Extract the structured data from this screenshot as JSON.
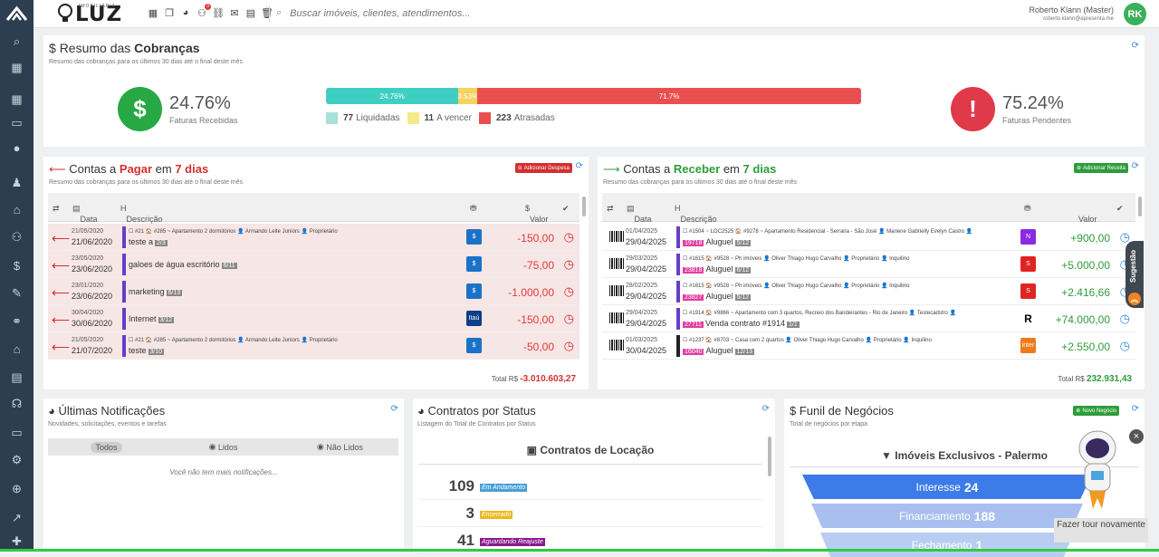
{
  "brand": {
    "sub": "IMOBILIÁRIA",
    "name": "LUZ"
  },
  "topbar": {
    "icons": [
      "dashboard-icon",
      "clone-icon",
      "comments-icon",
      "users-icon",
      "link-icon",
      "envelope-icon",
      "calendar-icon",
      "trash-icon"
    ],
    "notif_count": "3",
    "search_placeholder": "Buscar imóveis, clientes, atendimentos...",
    "user_name": "Roberto Klann (Master)",
    "user_email": "roberto.klann@apresenta.me",
    "avatar_initials": "RK"
  },
  "resumo": {
    "title_prefix": "Resumo das ",
    "title_bold": "Cobranças",
    "subtitle": "Resumo das cobranças para os últimos 30 dias até o final deste mês",
    "received_pct": "24.76%",
    "received_label": "Faturas Recebidas",
    "pending_pct": "75.24%",
    "pending_label": "Faturas Pendentes",
    "bar": [
      {
        "label": "24.76%",
        "value": 24.76,
        "color": "#3fcfc0"
      },
      {
        "label": "3.53%",
        "value": 3.53,
        "color": "#f4d35e"
      },
      {
        "label": "71.7%",
        "value": 71.7,
        "color": "#e94f4f"
      }
    ],
    "legend": [
      {
        "count": "77",
        "label": "Liquidadas",
        "color": "#a8e0da"
      },
      {
        "count": "11",
        "label": "A vencer",
        "color": "#f5e98a"
      },
      {
        "count": "223",
        "label": "Atrasadas",
        "color": "#e94f4f"
      }
    ]
  },
  "pagar": {
    "title_a": "Contas a ",
    "title_b": "Pagar",
    "title_c": " em ",
    "title_d": "7 dias",
    "subtitle": "Resumo das cobranças para os últimos 30 dias até o final deste mês",
    "button": "Adicionar Despesa",
    "col_data": "Data",
    "col_desc": "Descrição",
    "col_valor": "Valor",
    "rows": [
      {
        "d1": "21/05/2020",
        "d2": "21/06/2020",
        "meta": "☐ #21   🏠 #285 ~ Apartamento 2 dormitórios   👤 Armando Leite Juniors   👤 Proprietário",
        "desc": "teste a",
        "tag": "2/3",
        "bank": "$",
        "bank_color": "#1a73c8",
        "value": "-150,00"
      },
      {
        "d1": "23/05/2020",
        "d2": "23/06/2020",
        "meta": "",
        "desc": "galoes de água escritório",
        "tag": "6/11",
        "bank": "$",
        "bank_color": "#1a73c8",
        "value": "-75,00"
      },
      {
        "d1": "23/01/2020",
        "d2": "23/06/2020",
        "meta": "",
        "desc": "marketing",
        "tag": "6/13",
        "bank": "$",
        "bank_color": "#1a73c8",
        "value": "-1.000,00"
      },
      {
        "d1": "30/04/2020",
        "d2": "30/06/2020",
        "meta": "",
        "desc": "Internet",
        "tag": "3/12",
        "bank": "Itaú",
        "bank_color": "#0b3f8a",
        "value": "-150,00"
      },
      {
        "d1": "21/05/2020",
        "d2": "21/07/2020",
        "meta": "☐ #21   🏠 #285 ~ Apartamento 2 dormitórios   👤 Armando Leite Juniors   👤 Proprietário",
        "desc": "teste",
        "tag": "3/10",
        "bank": "$",
        "bank_color": "#1a73c8",
        "value": "-50,00"
      }
    ],
    "total_label": "Total R$",
    "total_value": "-3.010.603,27"
  },
  "receber": {
    "title_a": "Contas a ",
    "title_b": "Receber",
    "title_c": " em ",
    "title_d": "7 dias",
    "subtitle": "Resumo das cobranças para os últimos 30 dias até o final deste mês",
    "button": "Adicionar Receita",
    "col_data": "Data",
    "col_desc": "Descrição",
    "col_valor": "Valor",
    "rows": [
      {
        "d1": "01/04/2025",
        "d2": "29/04/2025",
        "meta": "☐ #1504 ~ LOC2525   🏠 #9278 ~ Apartamento Residencial - Serraria - São José   👤 Mariene Gabrielly Evelyn Castro   👤",
        "code": "19718",
        "desc": "Aluguel",
        "tag": "5/12",
        "bank": "N",
        "bank_color": "#8a2be2",
        "value": "+900,00"
      },
      {
        "d1": "29/03/2025",
        "d2": "29/04/2025",
        "meta": "☐ #1615   🏠 #9528 ~ Ph imóveis   👤 Oliver Thiago Hugo Carvalho   👤 Proprietário   👤 Inquilino",
        "code": "23818",
        "desc": "Aluguel",
        "tag": "6/12",
        "bank": "S",
        "bank_color": "#e02424",
        "value": "+5.000,00"
      },
      {
        "d1": "28/02/2025",
        "d2": "29/04/2025",
        "meta": "☐ #1615   🏠 #9528 ~ Ph imóveis   👤 Oliver Thiago Hugo Carvalho   👤 Proprietário   👤 Inquilino",
        "code": "23827",
        "desc": "Aluguel",
        "tag": "5/12",
        "bank": "S",
        "bank_color": "#e02424",
        "value": "+2.416,66"
      },
      {
        "d1": "29/04/2025",
        "d2": "29/04/2025",
        "meta": "☐ #1914   🏠 #9866 ~ Apartamento com 3 quartos, Recreio dos Bandeirantes - Rio de Janeiro   👤 Testecadstro   👤",
        "code": "27711",
        "desc": "Venda contrato #1914",
        "tag": "1/1",
        "bank": "R",
        "bank_color": "#fff",
        "value": "+74.000,00"
      },
      {
        "d1": "01/03/2025",
        "d2": "30/04/2025",
        "meta": "☐ #1237   🏠 #8703 ~ Casa com 2 quartos   👤 Oliver Thiago Hugo Carvalho   👤 Proprietário   👤 Inquilino",
        "code": "16040",
        "desc": "Aluguel",
        "tag": "12/13",
        "bank": "inter",
        "bank_color": "#f07a1a",
        "value": "+2.550,00"
      }
    ],
    "total_label": "Total R$",
    "total_value": "232.931,43"
  },
  "notif": {
    "title": "Últimas Notificações",
    "subtitle": "Novidades, solicitações, eventos e tarefas",
    "tab_all": "Todos",
    "tab_read": "Lidos",
    "tab_unread": "Não Lidos",
    "empty": "Você não tem mais notificações..."
  },
  "contratos": {
    "title": "Contratos por Status",
    "subtitle": "Listagem do Total de Contratos por Status",
    "section": "Contratos de Locação",
    "rows": [
      {
        "num": "109",
        "label": "Em Andamento",
        "color": "#4a9fd8"
      },
      {
        "num": "3",
        "label": "Encerrado",
        "color": "#e8b923"
      },
      {
        "num": "41",
        "label": "Aguardando Reajuste",
        "color": "#8b1a8b"
      }
    ]
  },
  "funil": {
    "title": "Funil de Negócios",
    "subtitle": "Total de negócios por etapa",
    "button": "Novo Negócio",
    "section": "Imóveis Exclusivos - Palermo",
    "stages": [
      {
        "label": "Interesse",
        "value": "24",
        "color": "#3c7be8"
      },
      {
        "label": "Financiamento",
        "value": "188",
        "color": "#a9bff0"
      },
      {
        "label": "Fechamento",
        "value": "1",
        "color": "#b9cdf2"
      }
    ]
  },
  "widget": {
    "sugestao": "Sugestão",
    "tour": "Fazer tour novamente",
    "close": "×"
  }
}
